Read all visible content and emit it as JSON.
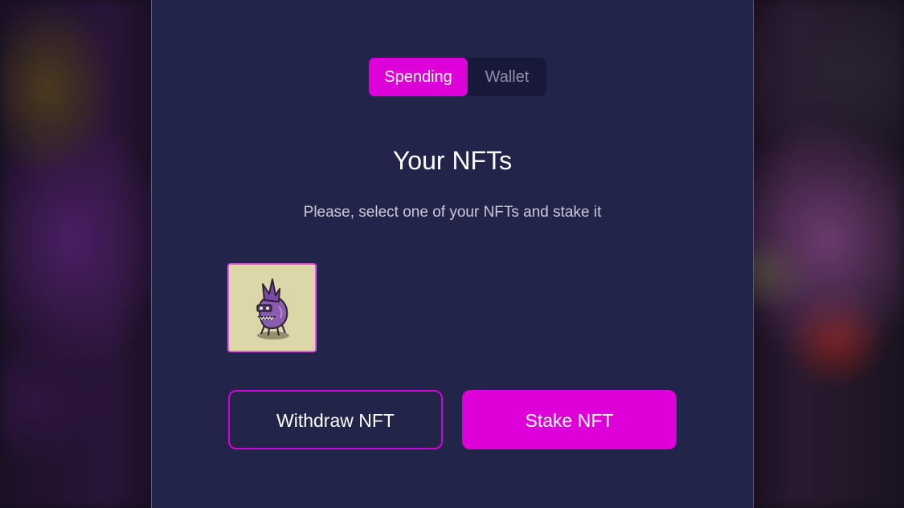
{
  "tabs": {
    "items": [
      {
        "label": "Spending",
        "active": true
      },
      {
        "label": "Wallet",
        "active": false
      }
    ]
  },
  "main": {
    "title": "Your NFTs",
    "subtitle": "Please, select one of your NFTs and stake it"
  },
  "nfts": [
    {
      "icon": "purple-creature-nft",
      "selected": true
    }
  ],
  "actions": {
    "withdraw_label": "Withdraw NFT",
    "stake_label": "Stake NFT"
  },
  "colors": {
    "accent": "#dd00d8",
    "panel": "#22244a",
    "tab_track": "#17183a",
    "nft_bg": "#dcd7a8"
  }
}
